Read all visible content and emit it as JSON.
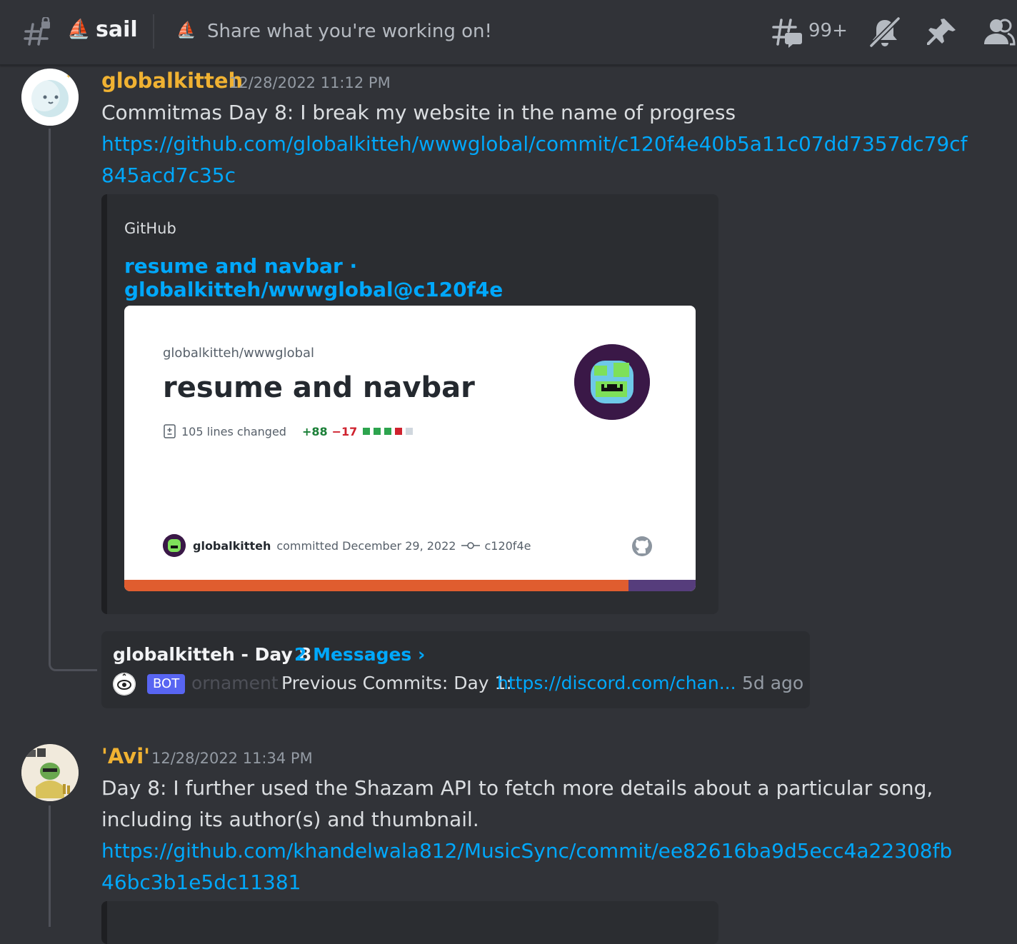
{
  "header": {
    "channel_name": "sail",
    "channel_emoji": "⛵",
    "topic_emoji": "⛵",
    "topic": "Share what you're working on!",
    "threads_count": "99+"
  },
  "messages": [
    {
      "username": "globalkitteh",
      "timestamp": "12/28/2022 11:12 PM",
      "text": "Commitmas Day 8: I break my website in the name of progress",
      "link_line1": "https://github.com/globalkitteh/wwwglobal/commit/c120f4e40b5a11c07dd7357dc79cf",
      "link_line2": "845acd7c35c",
      "embed": {
        "provider": "GitHub",
        "title": "resume and navbar · globalkitteh/wwwglobal@c120f4e",
        "card": {
          "repo": "globalkitteh/wwwglobal",
          "title": "resume and navbar",
          "lines_changed": "105 lines changed",
          "additions": "+88",
          "deletions": "−17",
          "author": "globalkitteh",
          "committed": "committed December 29, 2022",
          "sha": "c120f4e"
        }
      },
      "thread": {
        "name": "globalkitteh - Day 8",
        "messages": "2 Messages ›",
        "bot_badge": "BOT",
        "bot_name": "ornament",
        "preview": "Previous Commits: Day 1:",
        "preview_link": "https://discord.com/chan...",
        "ago": "5d ago"
      }
    },
    {
      "username": "'Avi'",
      "timestamp": "12/28/2022 11:34 PM",
      "text_line1": "Day 8: I further used the Shazam API to fetch more details about a particular song,",
      "text_line2": "including its author(s) and thumbnail.",
      "link_line1": "https://github.com/khandelwala812/MusicSync/commit/ee82616ba9d5ecc4a22308fb",
      "link_line2": "46bc3b1e5dc11381"
    }
  ],
  "colors": {
    "background": "#313338",
    "username": "#f0b232",
    "link": "#00a8fc",
    "embed_bg": "#2b2d31",
    "bot_badge": "#5865f2"
  },
  "icons": [
    "channel-hash-lock-icon",
    "threads-icon",
    "notification-muted-icon",
    "pin-icon",
    "member-list-icon",
    "github-icon",
    "file-diff-icon",
    "commit-icon"
  ]
}
